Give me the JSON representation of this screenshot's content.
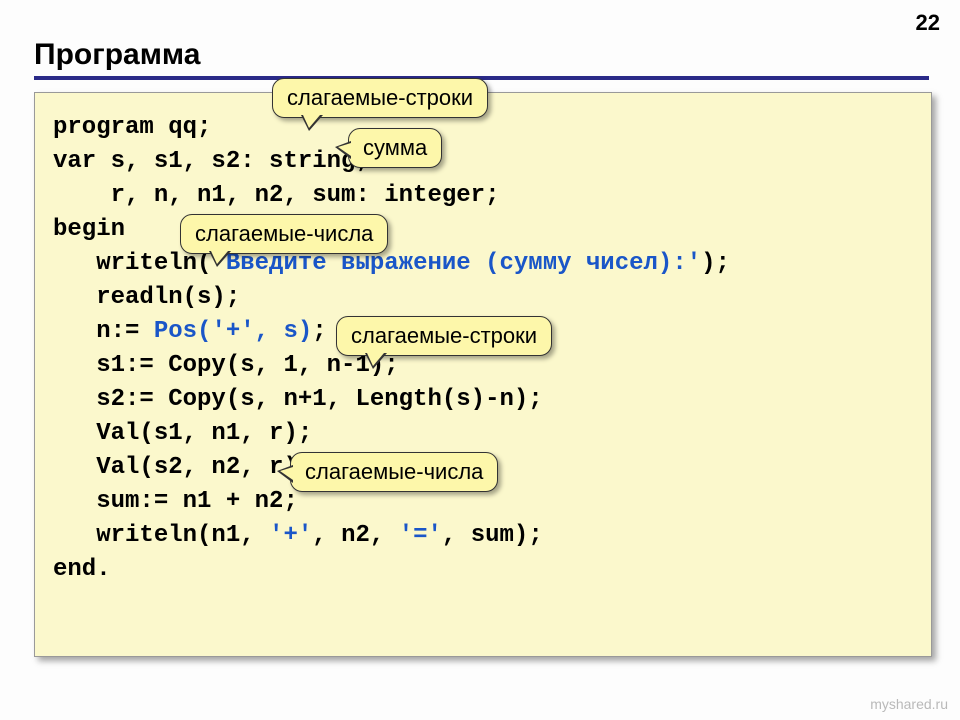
{
  "page_number": "22",
  "title": "Программа",
  "code": {
    "l1": "program qq;",
    "l2": "var s, s1, s2: string;",
    "l3": "    r, n, n1, n2, sum: integer;",
    "l4": "begin",
    "l5a": "   writeln(",
    "l5b": "'Введите выражение (сумму чисел):'",
    "l5c": ");",
    "l6": "   readln(s);",
    "l7a": "   n:= ",
    "l7b": "Pos('+', s)",
    "l7c": ";",
    "l8": "   s1:= Copy(s, 1, n-1);",
    "l9": "   s2:= Copy(s, n+1, Length(s)-n);",
    "l10": "   Val(s1, n1, r);",
    "l11": "   Val(s2, n2, r);",
    "l12": "   sum:= n1 + n2;",
    "l13a": "   writeln(n1, ",
    "l13b": "'+'",
    "l13c": ", n2, ",
    "l13d": "'='",
    "l13e": ", sum);",
    "l14": "end."
  },
  "callouts": {
    "c1": "слагаемые-строки",
    "c2": "сумма",
    "c3": "слагаемые-числа",
    "c4": "слагаемые-строки",
    "c5": "слагаемые-числа"
  },
  "watermark": "myshared.ru"
}
